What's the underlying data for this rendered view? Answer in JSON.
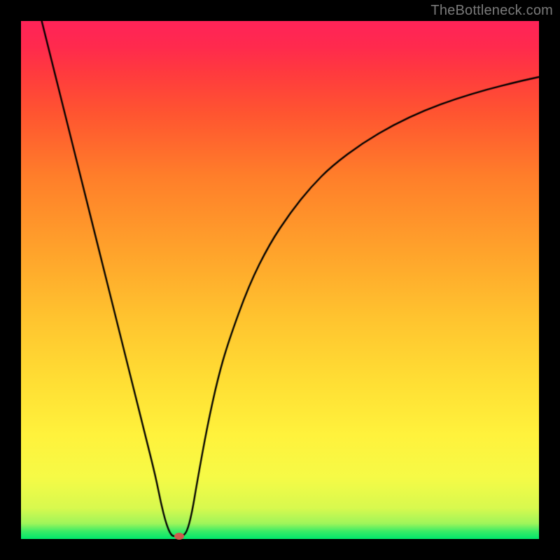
{
  "watermark": "TheBottleneck.com",
  "chart_data": {
    "type": "line",
    "title": "",
    "xlabel": "",
    "ylabel": "",
    "xlim": [
      0,
      100
    ],
    "ylim": [
      0,
      100
    ],
    "series": [
      {
        "name": "curve",
        "x": [
          4,
          6,
          8,
          10,
          12,
          14,
          16,
          18,
          20,
          22,
          24,
          26,
          27,
          28,
          29,
          30,
          31,
          32,
          33,
          34,
          36,
          38,
          40,
          44,
          48,
          52,
          56,
          60,
          66,
          72,
          78,
          84,
          90,
          96,
          100
        ],
        "y": [
          100,
          92,
          84,
          76,
          68,
          60,
          52,
          44,
          36,
          28,
          20,
          12,
          7,
          3,
          0.6,
          0.5,
          0.5,
          1.2,
          5,
          11,
          22,
          31,
          38,
          49,
          57,
          63,
          68,
          72,
          76.5,
          80,
          82.8,
          85,
          86.8,
          88.3,
          89.2
        ]
      }
    ],
    "marker": {
      "x": 30.5,
      "y": 0.5,
      "color": "#cf5a4d"
    },
    "background_gradient": {
      "bottom": "#00e86b",
      "mid": "#fff23c",
      "top": "#ff2358"
    }
  }
}
